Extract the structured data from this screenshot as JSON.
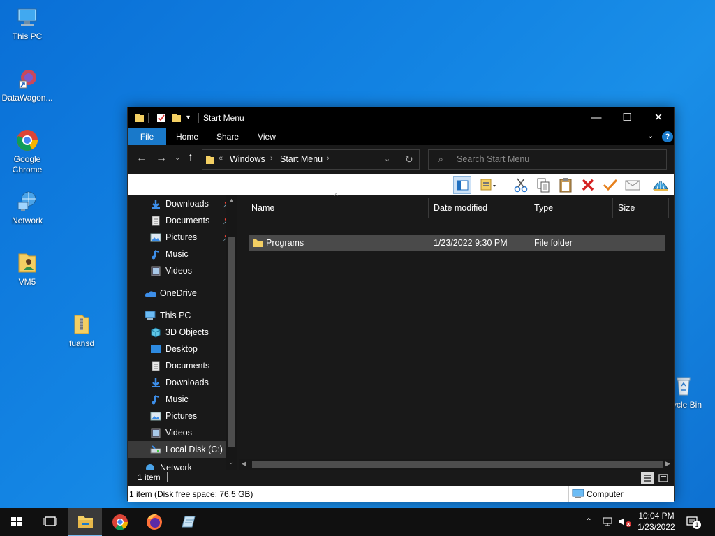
{
  "desktop": {
    "icons": [
      {
        "label": "This PC",
        "icon": "this-pc-icon"
      },
      {
        "label": "DataWagon...",
        "icon": "datawagon-shortcut-icon"
      },
      {
        "label": "Google Chrome",
        "icon": "chrome-icon"
      },
      {
        "label": "Network",
        "icon": "network-icon"
      },
      {
        "label": "VM5",
        "icon": "user-folder-icon"
      },
      {
        "label": "fuansd",
        "icon": "zip-folder-icon"
      },
      {
        "label": "ycle Bin",
        "icon": "recycle-bin-icon"
      }
    ]
  },
  "window": {
    "title": "Start Menu",
    "controls": {
      "minimize": "—",
      "maximize": "☐",
      "close": "✕"
    },
    "ribbon_tabs": [
      "File",
      "Home",
      "Share",
      "View"
    ],
    "address": {
      "prefix": "«",
      "segments": [
        "Windows",
        "Start Menu"
      ]
    },
    "search_placeholder": "Search Start Menu",
    "nav": {
      "quick_access": [
        {
          "label": "Downloads",
          "icon": "download-arrow-icon",
          "pinned": true
        },
        {
          "label": "Documents",
          "icon": "documents-icon",
          "pinned": true
        },
        {
          "label": "Pictures",
          "icon": "pictures-icon",
          "pinned": true
        },
        {
          "label": "Music",
          "icon": "music-note-icon",
          "pinned": false
        },
        {
          "label": "Videos",
          "icon": "videos-icon",
          "pinned": false
        }
      ],
      "onedrive": "OneDrive",
      "this_pc": "This PC",
      "this_pc_items": [
        {
          "label": "3D Objects",
          "icon": "3d-objects-icon"
        },
        {
          "label": "Desktop",
          "icon": "desktop-icon"
        },
        {
          "label": "Documents",
          "icon": "documents-icon"
        },
        {
          "label": "Downloads",
          "icon": "download-arrow-icon"
        },
        {
          "label": "Music",
          "icon": "music-note-icon"
        },
        {
          "label": "Pictures",
          "icon": "pictures-icon"
        },
        {
          "label": "Videos",
          "icon": "videos-icon"
        },
        {
          "label": "Local Disk (C:)",
          "icon": "local-disk-icon"
        }
      ],
      "partial_item": "Network"
    },
    "columns": [
      "Name",
      "Date modified",
      "Type",
      "Size"
    ],
    "files": [
      {
        "name": "Programs",
        "date": "1/23/2022 9:30 PM",
        "type": "File folder",
        "size": ""
      }
    ],
    "status": {
      "item_count": "1 item"
    },
    "bottom": {
      "left": "1 item (Disk free space: 76.5 GB)",
      "right": "Computer"
    }
  },
  "taskbar": {
    "time": "10:04 PM",
    "date": "1/23/2022",
    "notification_count": "1"
  },
  "colors": {
    "accent": "#1979ca",
    "window_bg": "#191919",
    "selection": "#4a4a4a",
    "taskbar": "#101010"
  }
}
